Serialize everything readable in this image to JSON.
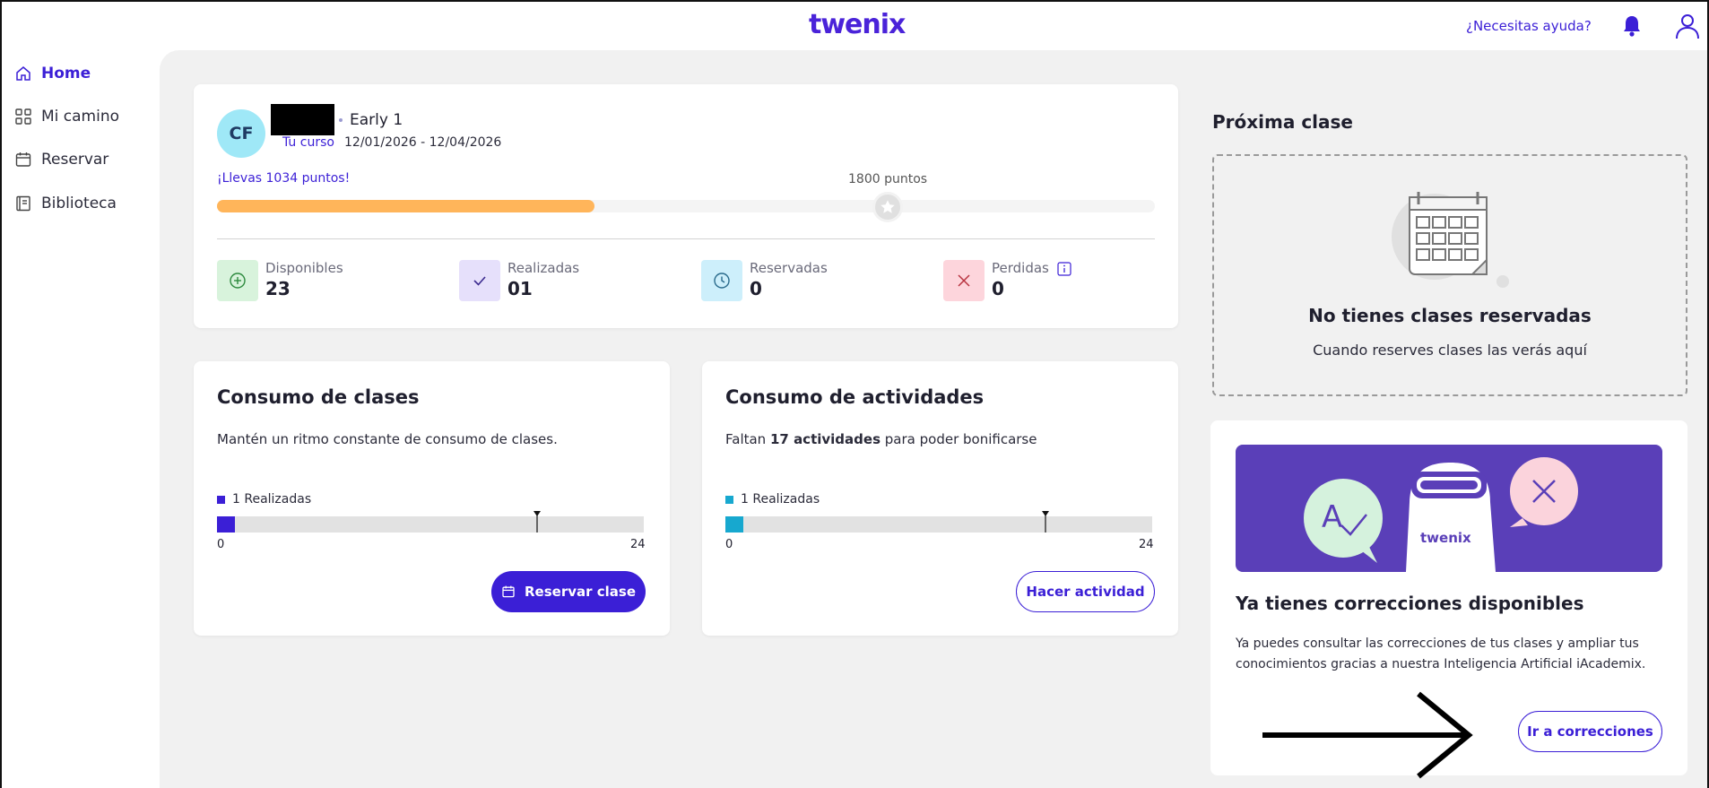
{
  "header": {
    "logo": "twenix",
    "help_link": "¿Necesitas ayuda?"
  },
  "sidebar": {
    "items": [
      {
        "label": "Home",
        "icon": "home-icon",
        "active": true
      },
      {
        "label": "Mi camino",
        "icon": "grid-icon",
        "active": false
      },
      {
        "label": "Reservar",
        "icon": "calendar-icon",
        "active": false
      },
      {
        "label": "Biblioteca",
        "icon": "book-icon",
        "active": false
      }
    ]
  },
  "profile": {
    "initials": "CF",
    "level": "Early 1",
    "course_label": "Tu curso",
    "course_dates": "12/01/2026 - 12/04/2026",
    "points_text": "¡Llevas 1034 puntos!",
    "points_goal": "1800 puntos",
    "points_current": 1034,
    "points_target": 1800,
    "progress_color": "#ffb55a"
  },
  "stats": [
    {
      "label": "Disponibles",
      "value": "23",
      "icon": "plus-circle-icon",
      "bg": "#d8f3dc",
      "color": "#2d8a3e"
    },
    {
      "label": "Realizadas",
      "value": "01",
      "icon": "check-icon",
      "bg": "#e6e0fb",
      "color": "#3b2a8f"
    },
    {
      "label": "Reservadas",
      "value": "0",
      "icon": "clock-icon",
      "bg": "#cdeffb",
      "color": "#2a6b8c"
    },
    {
      "label": "Perdidas",
      "value": "0",
      "icon": "x-icon",
      "bg": "#fdd5dc",
      "color": "#b8323f"
    }
  ],
  "class_consumption": {
    "title": "Consumo de clases",
    "description": "Mantén un ritmo constante de consumo de clases.",
    "legend": "1 Realizadas",
    "done": 1,
    "max": 24,
    "target": 18,
    "min_label": "0",
    "max_label": "24",
    "color": "#3b1fd6",
    "button": "Reservar clase"
  },
  "activity_consumption": {
    "title": "Consumo de actividades",
    "description_prefix": "Faltan ",
    "description_bold": "17 actividades",
    "description_suffix": " para poder bonificarse",
    "legend": "1 Realizadas",
    "done": 1,
    "max": 24,
    "target": 18,
    "min_label": "0",
    "max_label": "24",
    "color": "#17a8cf",
    "button": "Hacer actividad"
  },
  "next_class": {
    "title": "Próxima clase",
    "empty_title": "No tienes clases reservadas",
    "empty_desc": "Cuando reserves clases las verás aquí"
  },
  "corrections": {
    "banner_logo": "twenix",
    "title": "Ya tienes correcciones disponibles",
    "description": "Ya puedes consultar las correcciones de tus clases y ampliar tus conocimientos gracias a nuestra Inteligencia Artificial iAcademix.",
    "button": "Ir a correcciones"
  },
  "colors": {
    "accent": "#3b1fd6",
    "background": "#f1f1f1"
  }
}
